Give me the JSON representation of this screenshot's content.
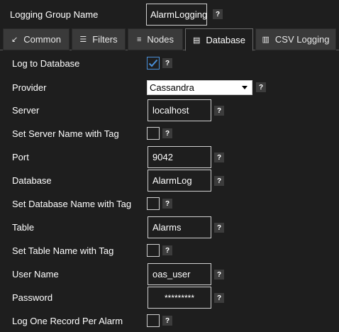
{
  "header": {
    "group_name_label": "Logging Group Name",
    "group_name_value": "AlarmLogging"
  },
  "tabs": [
    {
      "label": "Common",
      "icon": "common-icon"
    },
    {
      "label": "Filters",
      "icon": "filters-icon"
    },
    {
      "label": "Nodes",
      "icon": "nodes-icon"
    },
    {
      "label": "Database",
      "icon": "database-icon",
      "active": true
    },
    {
      "label": "CSV Logging",
      "icon": "csv-icon"
    }
  ],
  "help_glyph": "?",
  "form": {
    "log_to_database": {
      "label": "Log to Database",
      "checked": true
    },
    "provider": {
      "label": "Provider",
      "value": "Cassandra"
    },
    "server": {
      "label": "Server",
      "value": "localhost"
    },
    "server_name_with_tag": {
      "label": "Set Server Name with Tag",
      "checked": false
    },
    "port": {
      "label": "Port",
      "value": "9042"
    },
    "database": {
      "label": "Database",
      "value": "AlarmLog"
    },
    "database_name_with_tag": {
      "label": "Set Database Name with Tag",
      "checked": false
    },
    "table": {
      "label": "Table",
      "value": "Alarms"
    },
    "table_name_with_tag": {
      "label": "Set Table Name with Tag",
      "checked": false
    },
    "user_name": {
      "label": "User Name",
      "value": "oas_user"
    },
    "password": {
      "label": "Password",
      "value": "*********"
    },
    "log_one_record": {
      "label": "Log One Record Per Alarm",
      "checked": false
    }
  },
  "colors": {
    "background": "#1e1e1e",
    "accent": "#4a90d9",
    "tab_inactive": "#3a3a3a",
    "help_bg": "#3c3c3c"
  }
}
